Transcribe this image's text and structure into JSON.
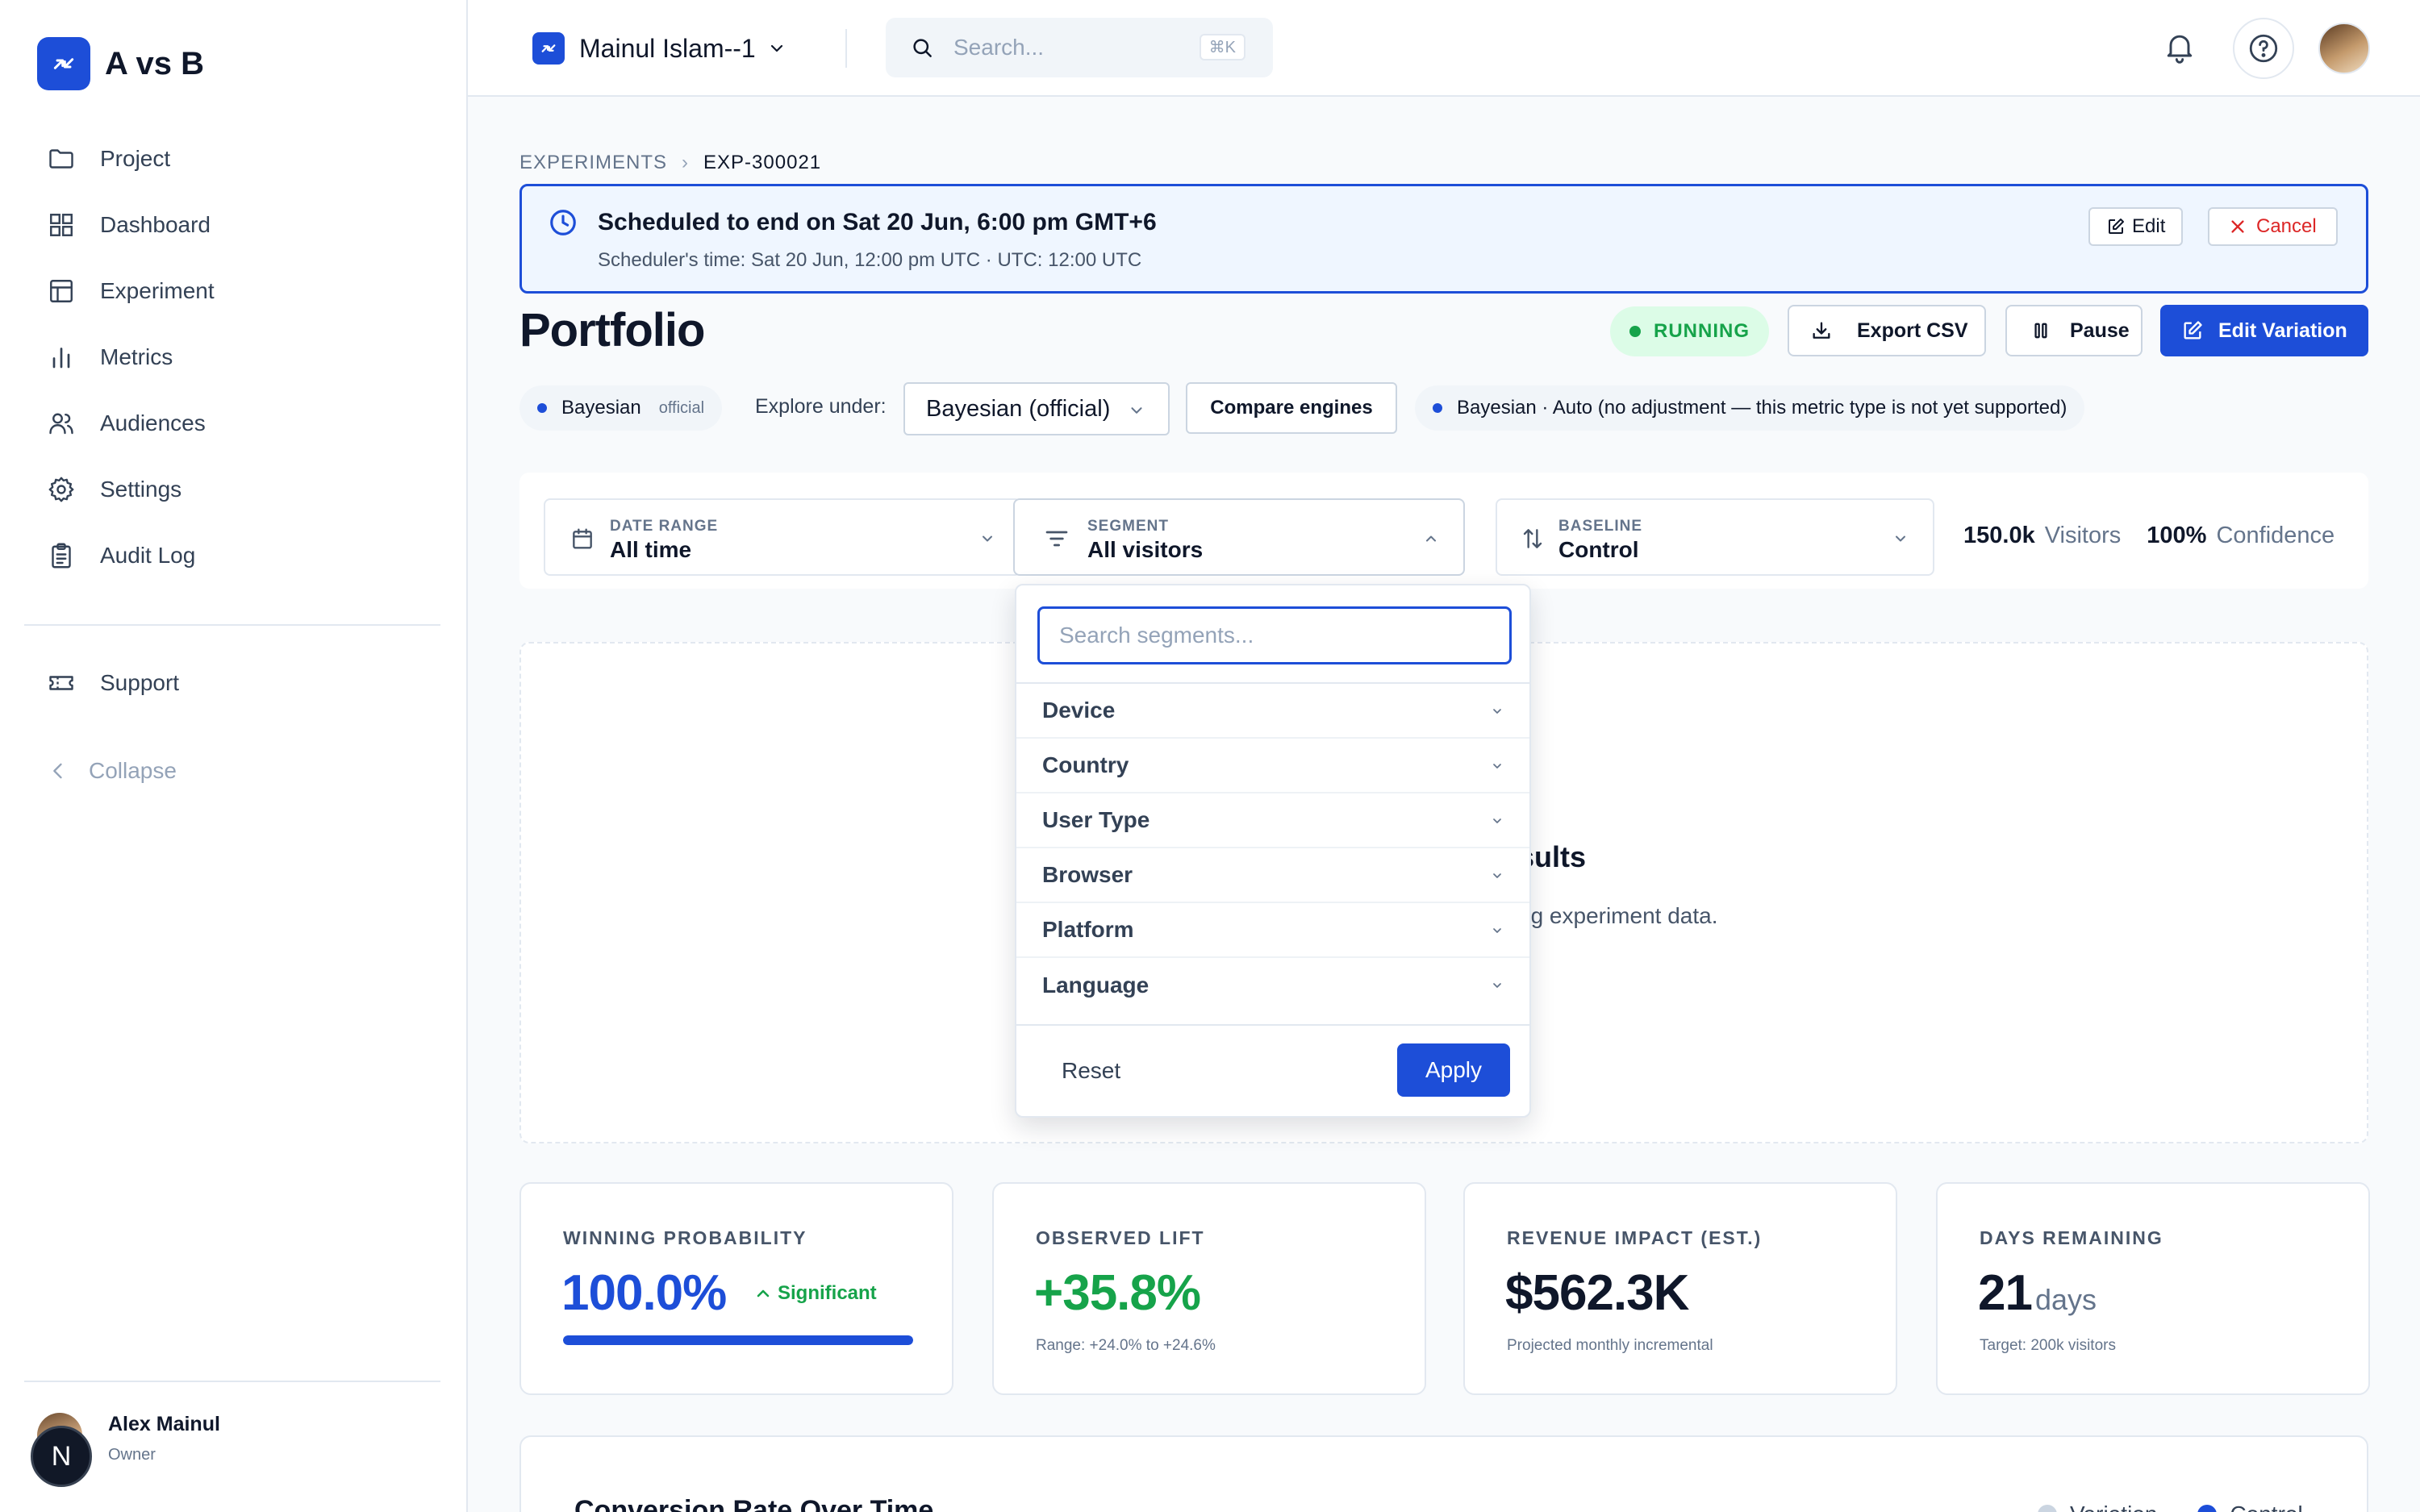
{
  "app": {
    "name": "A vs B"
  },
  "sidebar": {
    "items": [
      {
        "label": "Project",
        "icon": "folder-icon"
      },
      {
        "label": "Dashboard",
        "icon": "grid-icon"
      },
      {
        "label": "Experiment",
        "icon": "table-icon"
      },
      {
        "label": "Metrics",
        "icon": "bar-chart-icon"
      },
      {
        "label": "Audiences",
        "icon": "users-icon"
      },
      {
        "label": "Settings",
        "icon": "gear-icon"
      },
      {
        "label": "Audit Log",
        "icon": "clipboard-icon"
      }
    ],
    "support": "Support",
    "collapse": "Collapse",
    "user": {
      "name": "Alex Mainul",
      "role": "Owner",
      "initial": "N"
    }
  },
  "topbar": {
    "workspace": "Mainul Islam--1",
    "search_placeholder": "Search...",
    "search_shortcut": "⌘K"
  },
  "breadcrumb": {
    "section": "EXPERIMENTS",
    "current": "EXP-300021"
  },
  "banner": {
    "title": "Scheduled to end on Sat 20 Jun, 6:00 pm GMT+6",
    "subtitle": "Scheduler's time: Sat 20 Jun, 12:00 pm UTC · UTC: 12:00 UTC",
    "edit": "Edit",
    "cancel": "Cancel"
  },
  "page": {
    "title": "Portfolio",
    "status": "RUNNING",
    "export": "Export CSV",
    "pause": "Pause",
    "edit_variation": "Edit Variation"
  },
  "engine": {
    "chip_label": "Bayesian",
    "chip_tag": "official",
    "explore_label": "Explore under:",
    "explore_value": "Bayesian (official)",
    "compare": "Compare engines",
    "note": "Bayesian · Auto (no adjustment — this metric type is not yet supported)"
  },
  "filters": {
    "date_range": {
      "label": "DATE RANGE",
      "value": "All time"
    },
    "segment": {
      "label": "SEGMENT",
      "value": "All visitors"
    },
    "baseline": {
      "label": "BASELINE",
      "value": "Control"
    },
    "visitors_value": "150.0k",
    "visitors_label": "Visitors",
    "confidence_value": "100%",
    "confidence_label": "Confidence"
  },
  "results": {
    "title_visible": "sults",
    "sub_visible": "ng experiment data."
  },
  "segment_dropdown": {
    "search_placeholder": "Search segments...",
    "search_value": "",
    "groups": [
      "Device",
      "Country",
      "User Type",
      "Browser",
      "Platform",
      "Language"
    ],
    "reset": "Reset",
    "apply": "Apply"
  },
  "kpis": {
    "winning": {
      "label": "WINNING PROBABILITY",
      "value": "100.0%",
      "badge": "Significant",
      "progress": 1.0
    },
    "lift": {
      "label": "OBSERVED LIFT",
      "value": "+35.8%",
      "sub": "Range: +24.0% to +24.6%"
    },
    "revenue": {
      "label": "REVENUE IMPACT (EST.)",
      "value": "$562.3K",
      "sub": "Projected monthly incremental"
    },
    "days": {
      "label": "DAYS REMAINING",
      "value": "21",
      "unit": "days",
      "sub": "Target: 200k visitors"
    }
  },
  "chart": {
    "title": "Conversion Rate Over Time",
    "legend": [
      "Variation",
      "Control"
    ]
  },
  "colors": {
    "accent": "#1d4ed8",
    "success": "#16a34a",
    "danger": "#dc2626",
    "legend_variation": "#cbd5e1",
    "legend_control": "#1d4ed8"
  }
}
